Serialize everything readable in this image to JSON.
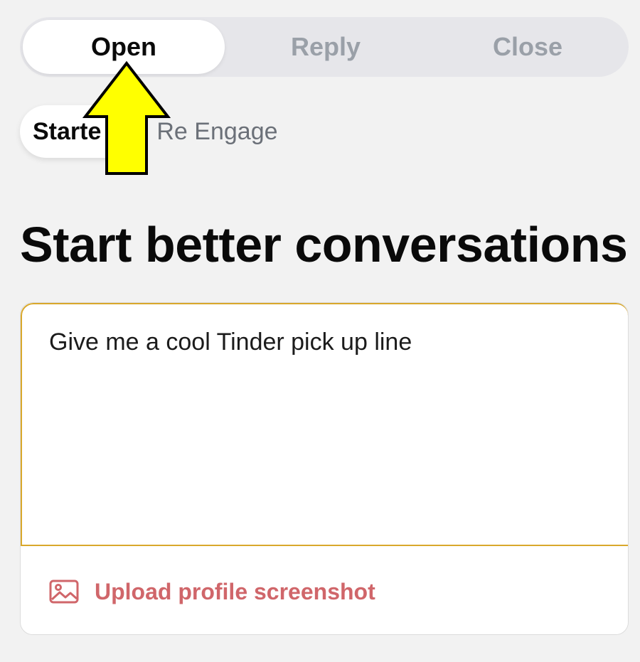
{
  "segmented": {
    "tabs": [
      {
        "label": "Open",
        "active": true
      },
      {
        "label": "Reply",
        "active": false
      },
      {
        "label": "Close",
        "active": false
      }
    ]
  },
  "subtabs": {
    "items": [
      {
        "label": "Starte",
        "active": true
      },
      {
        "label": "Re Engage",
        "active": false
      }
    ]
  },
  "heading": "Start better conversations",
  "prompt": {
    "value": "Give me a cool Tinder pick up line"
  },
  "upload": {
    "label": "Upload profile screenshot",
    "icon": "image-icon"
  },
  "colors": {
    "accent": "#d0666a",
    "input_border": "#d9a82b",
    "arrow_fill": "#ffff00"
  }
}
